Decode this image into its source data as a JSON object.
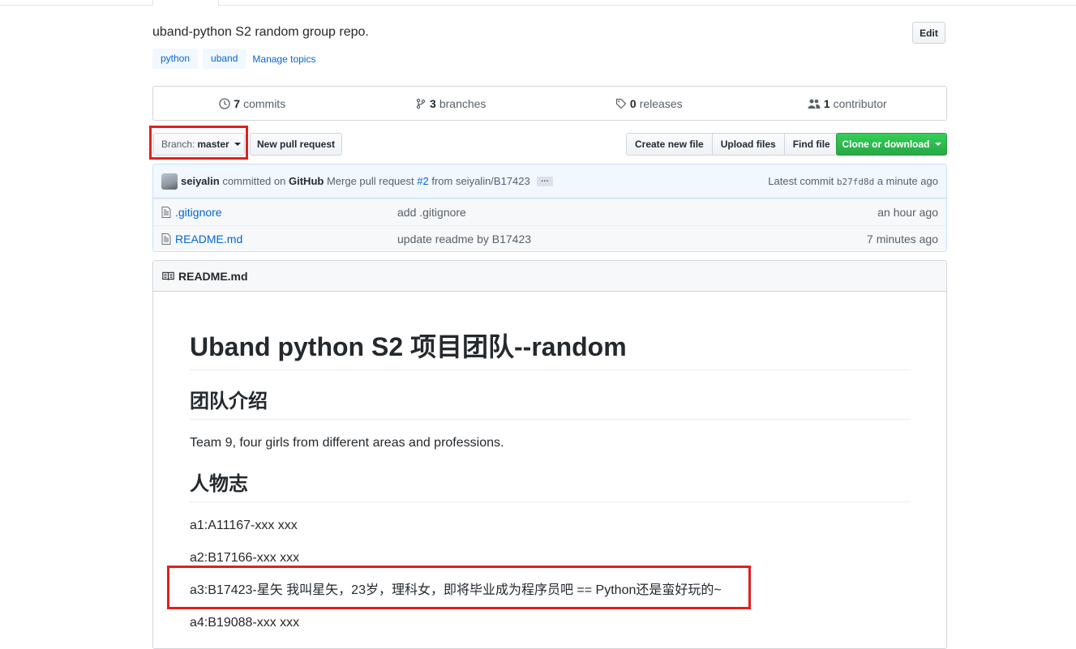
{
  "repo": {
    "description": "uband-python S2 random group repo.",
    "edit_label": "Edit",
    "topics": [
      "python",
      "uband"
    ],
    "manage_topics": "Manage topics"
  },
  "stats": {
    "commits_count": "7",
    "commits_label": "commits",
    "branches_count": "3",
    "branches_label": "branches",
    "releases_count": "0",
    "releases_label": "releases",
    "contributors_count": "1",
    "contributors_label": "contributor"
  },
  "toolbar": {
    "branch_prefix": "Branch:",
    "branch_name": "master",
    "new_pr": "New pull request",
    "create_file": "Create new file",
    "upload_files": "Upload files",
    "find_file": "Find file",
    "clone": "Clone or download"
  },
  "commit": {
    "author": "seiyalin",
    "committed_on": "committed on",
    "platform": "GitHub",
    "message_prefix": "Merge pull request",
    "pr_number": "#2",
    "message_suffix": "from seiyalin/B17423",
    "ellipsis": "…",
    "latest_label": "Latest commit",
    "sha": "b27fd8d",
    "time": "a minute ago"
  },
  "files": [
    {
      "name": ".gitignore",
      "message": "add .gitignore",
      "age": "an hour ago"
    },
    {
      "name": "README.md",
      "message": "update readme by B17423",
      "age": "7 minutes ago"
    }
  ],
  "readme": {
    "header": "README.md",
    "h1": "Uband python S2 项目团队--random",
    "h2_team": "团队介绍",
    "team_desc": "Team 9, four girls from different areas and professions.",
    "h2_people": "人物志",
    "members": [
      "a1:A11167-xxx xxx",
      "a2:B17166-xxx xxx",
      "a3:B17423-星矢 我叫星矢，23岁，理科女，即将毕业成为程序员吧 == Python还是蛮好玩的~",
      "a4:B19088-xxx xxx"
    ]
  },
  "colors": {
    "accent": "#0366d6",
    "highlight": "#e02020",
    "clone_green": "#28a745"
  }
}
